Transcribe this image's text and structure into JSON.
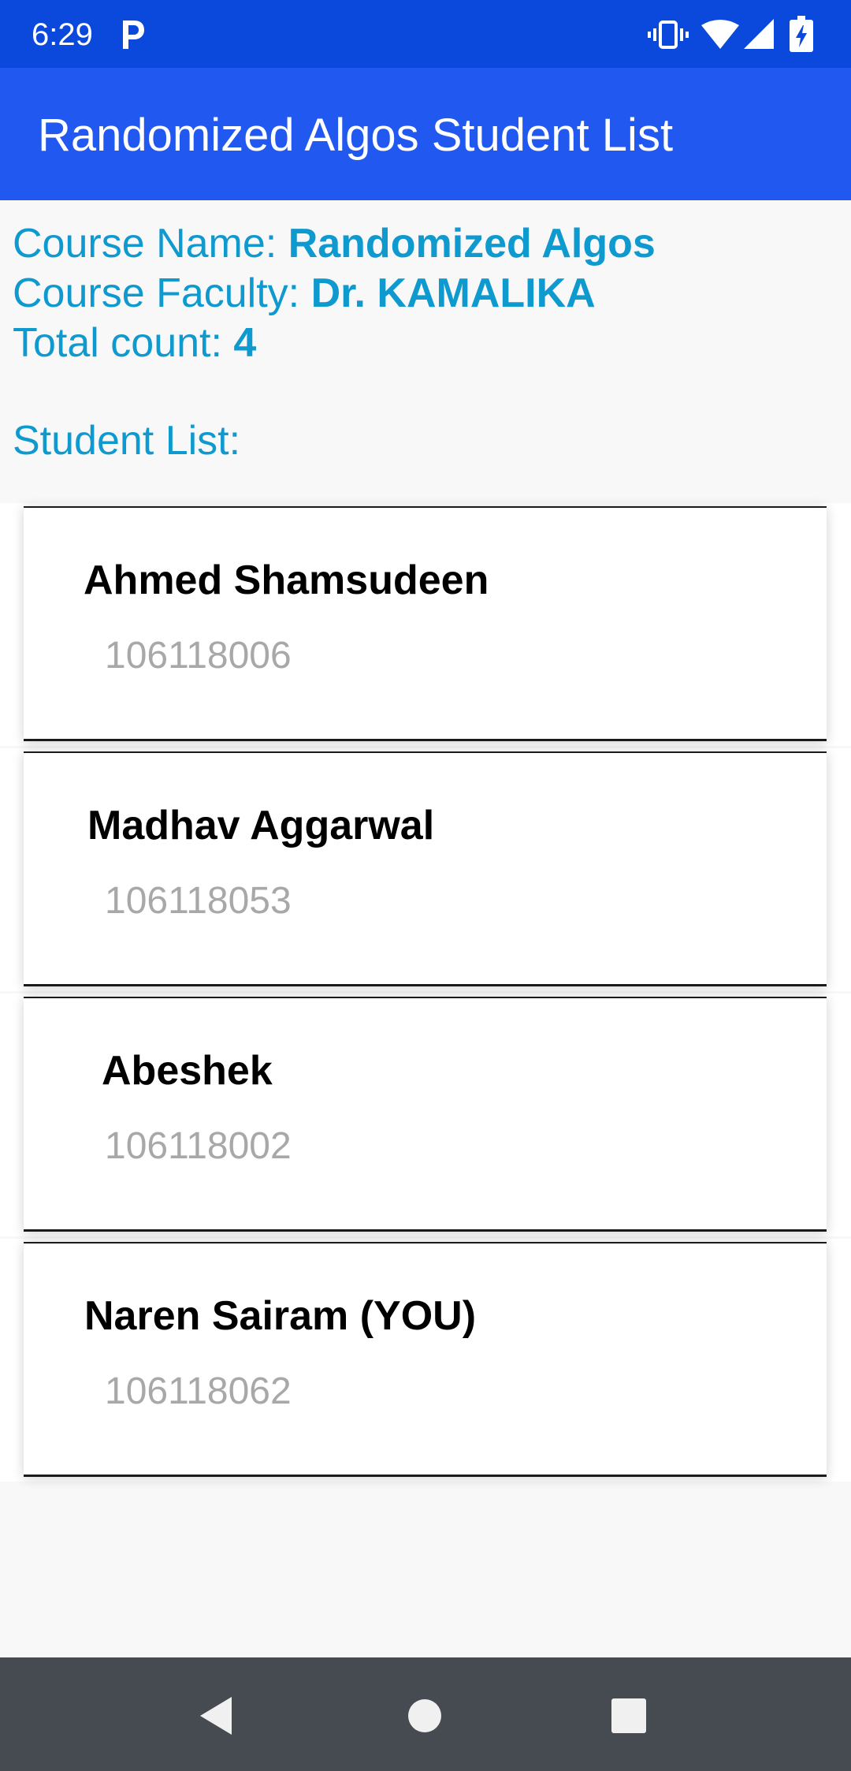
{
  "status_bar": {
    "time": "6:29",
    "icons": [
      "p-notification-icon",
      "vibrate-icon",
      "wifi-icon",
      "signal-icon",
      "battery-charging-icon"
    ]
  },
  "app_bar": {
    "title": "Randomized Algos Student List"
  },
  "course": {
    "name_label": "Course Name: ",
    "name_value": "Randomized Algos",
    "faculty_label": "Course Faculty: ",
    "faculty_value": "Dr. KAMALIKA",
    "count_label": "Total count: ",
    "count_value": "4"
  },
  "list_heading": "Student List:",
  "students": [
    {
      "name": "Ahmed Shamsudeen",
      "id": "106118006"
    },
    {
      "name": "Madhav Aggarwal",
      "id": "106118053"
    },
    {
      "name": "Abeshek",
      "id": "106118002"
    },
    {
      "name": "Naren Sairam (YOU)",
      "id": "106118062"
    }
  ],
  "nav_bar": {
    "icons": [
      "back-icon",
      "home-icon",
      "recents-icon"
    ]
  },
  "colors": {
    "status_bar": "#0b49dd",
    "app_bar": "#2158ef",
    "accent_text": "#0e99cf",
    "nav_bar": "#454b51",
    "id_text": "#a8a8a8"
  }
}
